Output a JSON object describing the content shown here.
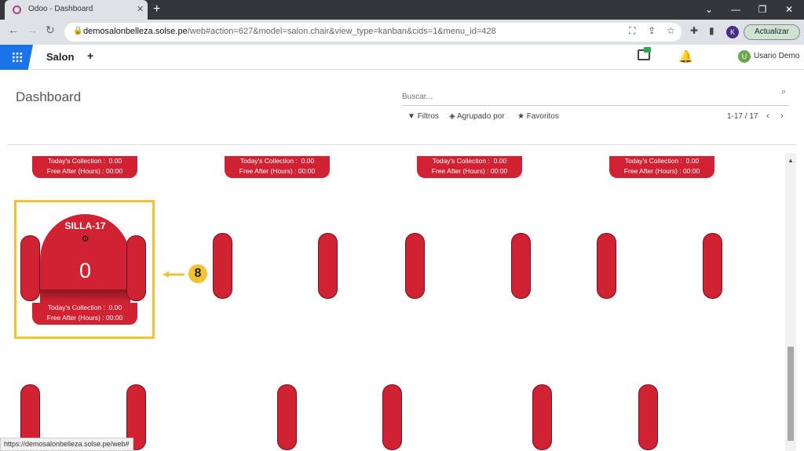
{
  "browser": {
    "tab_title": "Odoo - Dashboard",
    "new_tab": "+",
    "url_host": "demosalonbelleza.solse.pe",
    "url_path": "/web#action=627&model=salon.chair&view_type=kanban&cids=1&menu_id=428",
    "profile_initial": "K",
    "update_label": "Actualizar",
    "status_url": "https://demosalonbelleza.solse.pe/web#"
  },
  "navbar": {
    "app_name": "Salon",
    "plus": "+",
    "user_initial": "U",
    "user_name": "Usario Demo"
  },
  "control_panel": {
    "title": "Dashboard",
    "search_placeholder": "Buscar...",
    "filters_label": "Filtros",
    "group_by_label": "Agrupado por",
    "favorites_label": "Favoritos",
    "pager": "1-17 / 17"
  },
  "kanban": {
    "collection_label": "Today's Collection :",
    "collection_value": "0.00",
    "free_after_label": "Free After (Hours) :",
    "free_after_value": "00:00",
    "highlighted_chair": {
      "name": "SILLA-17",
      "count": "0"
    }
  },
  "annotation": {
    "number": "8",
    "color": "#f1c232"
  },
  "colors": {
    "chair_red": "#d12233",
    "odoo_blue": "#1a73e8"
  }
}
